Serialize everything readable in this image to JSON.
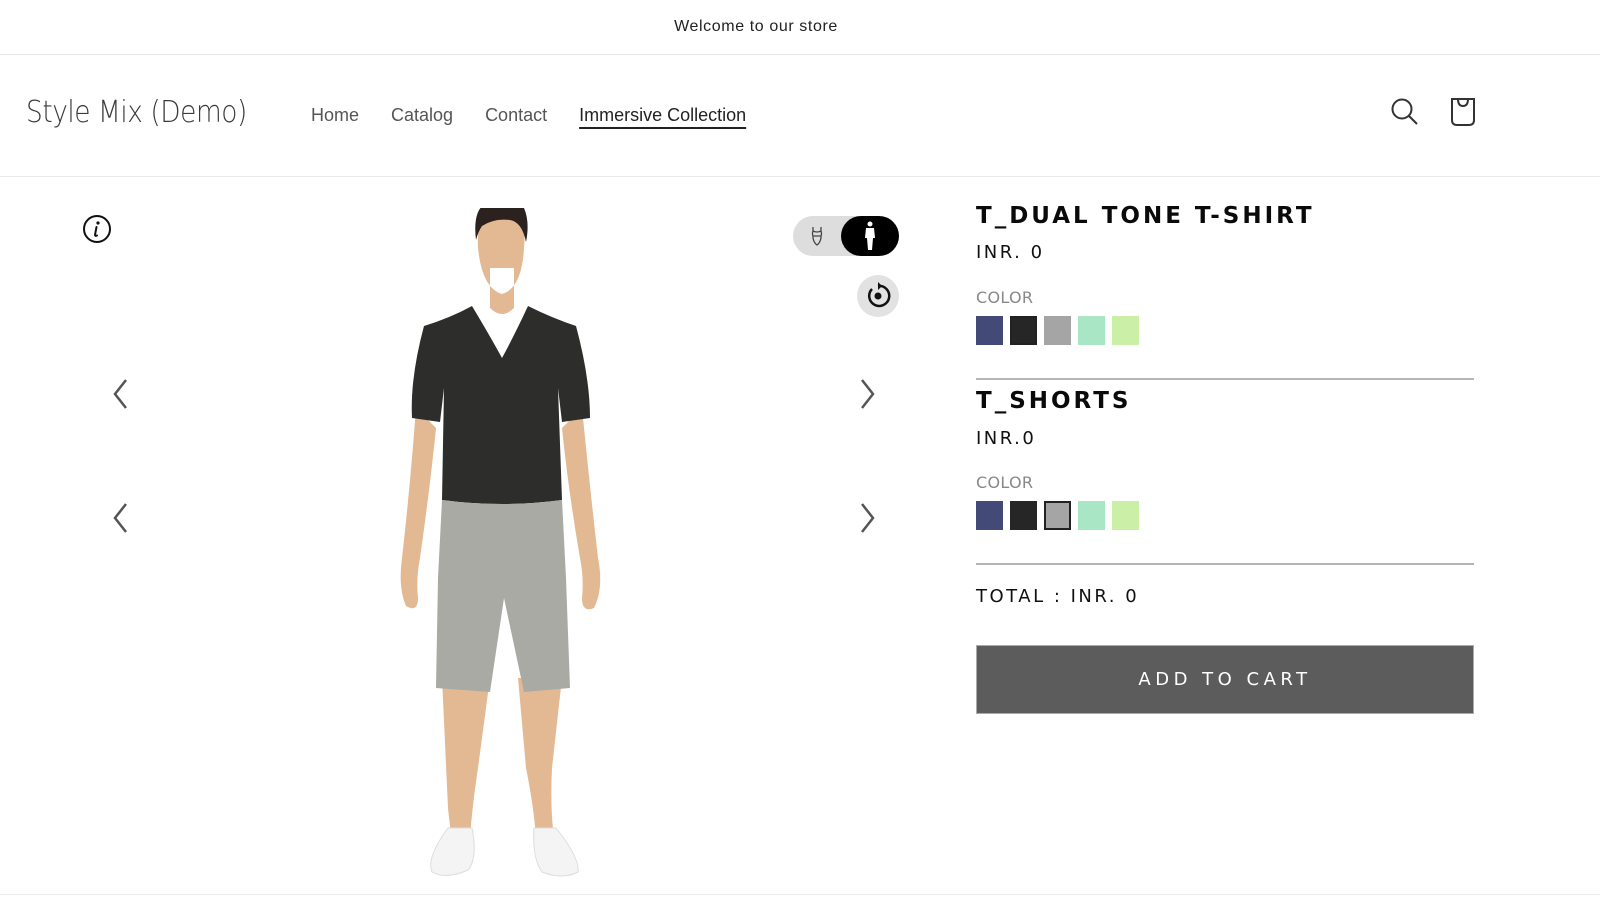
{
  "announcement": {
    "text": "Welcome to our store"
  },
  "header": {
    "logo": "Style Mix (Demo)",
    "nav": [
      {
        "label": "Home",
        "active": false
      },
      {
        "label": "Catalog",
        "active": false
      },
      {
        "label": "Contact",
        "active": false
      },
      {
        "label": "Immersive Collection",
        "active": true
      }
    ],
    "icons": {
      "search": "search-icon",
      "cart": "cart-icon"
    }
  },
  "viewer": {
    "info_icon": "info-icon",
    "view_toggle": {
      "options": [
        "body-icon",
        "full-body-icon"
      ],
      "selected": "full-body-icon"
    },
    "reset_icon": "rotate-reset-icon",
    "arrows": [
      "chevron-left-icon",
      "chevron-right-icon"
    ],
    "model_colors": {
      "shirt": "#2d2d2b",
      "shorts": "#a9aaa4",
      "skin": "#e3b994",
      "hair": "#2b2220",
      "shoes": "#f4f4f4"
    }
  },
  "products": [
    {
      "title": "T_DUAL TONE T-SHIRT",
      "price": "INR. 0",
      "color_label": "COLOR",
      "swatches": [
        {
          "color": "#434a78",
          "selected": false
        },
        {
          "color": "#262626",
          "selected": true
        },
        {
          "color": "#a5a5a5",
          "selected": false
        },
        {
          "color": "#a8e6c5",
          "selected": false
        },
        {
          "color": "#ccefa8",
          "selected": false
        }
      ]
    },
    {
      "title": "T_SHORTS",
      "price": "INR.0",
      "color_label": "COLOR",
      "swatches": [
        {
          "color": "#434a78",
          "selected": false
        },
        {
          "color": "#262626",
          "selected": false
        },
        {
          "color": "#a5a5a5",
          "selected": true
        },
        {
          "color": "#a8e6c5",
          "selected": false
        },
        {
          "color": "#ccefa8",
          "selected": false
        }
      ]
    }
  ],
  "total": "TOTAL : INR. 0",
  "add_to_cart": "ADD TO CART",
  "colors": {
    "button_bg": "#5c5c5c",
    "divider": "#b5b5b5"
  }
}
